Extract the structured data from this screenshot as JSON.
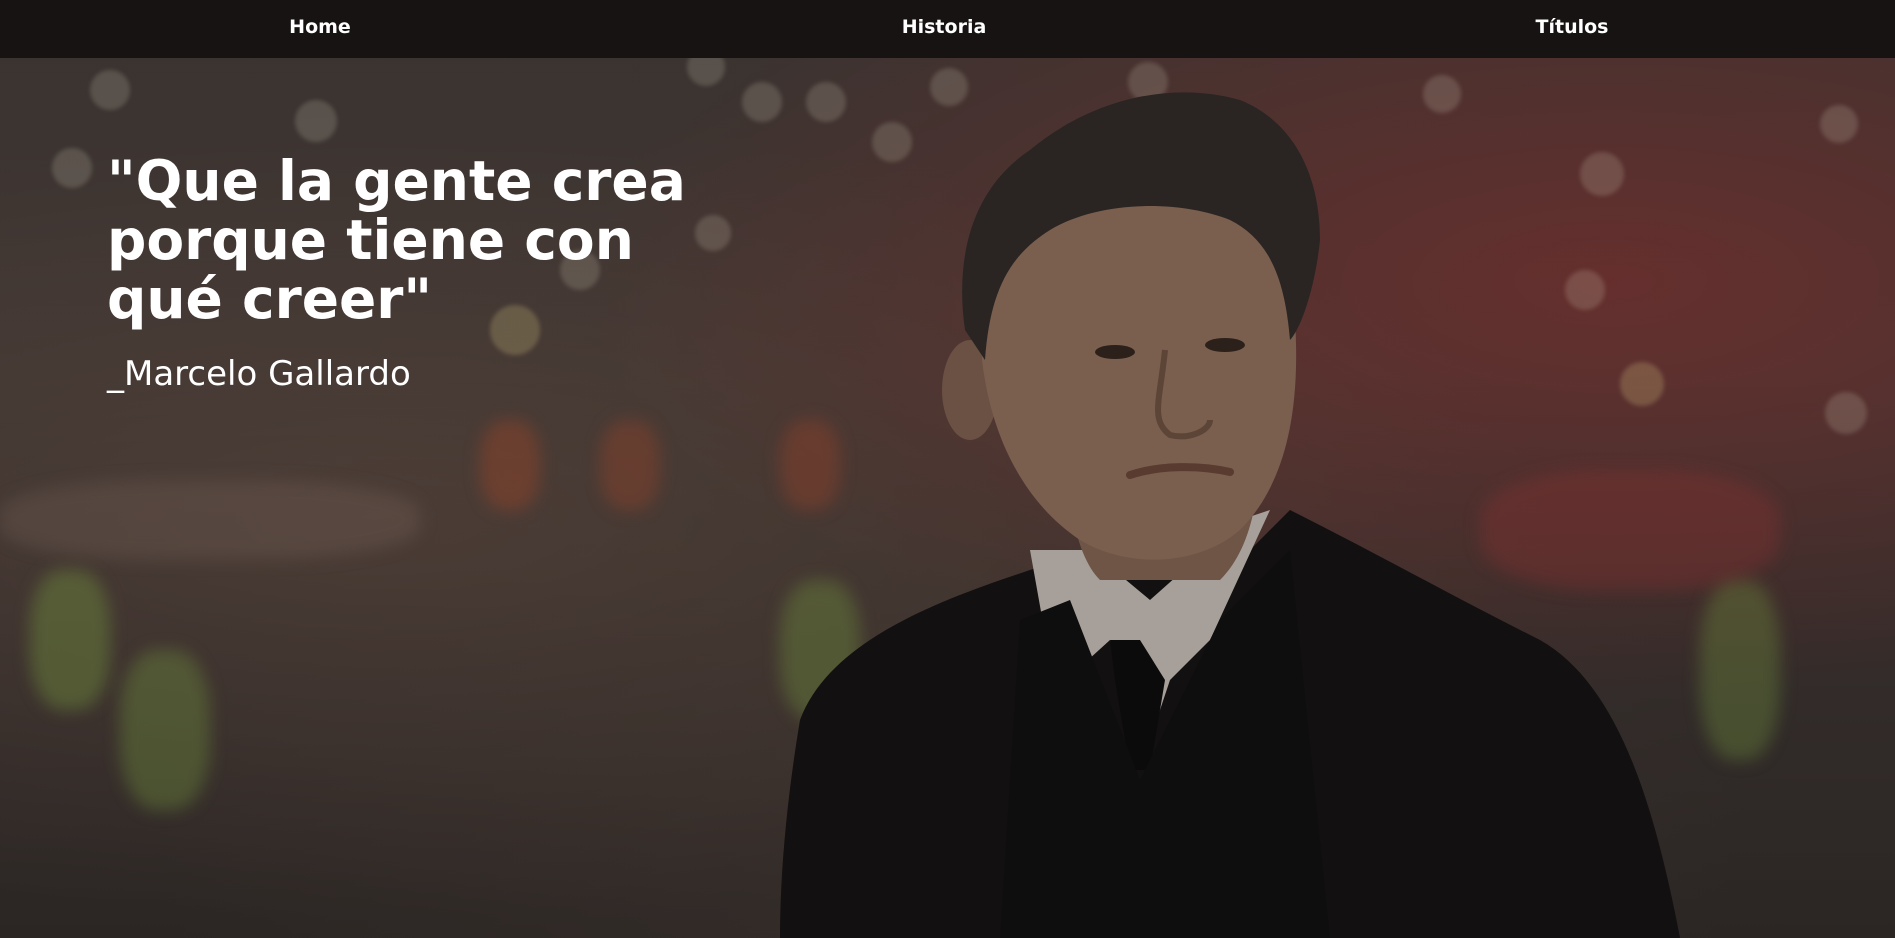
{
  "navbar": {
    "items": [
      {
        "label": "Home"
      },
      {
        "label": "Historia"
      },
      {
        "label": "Títulos"
      }
    ]
  },
  "hero": {
    "quote": "\"Que la gente crea porque tiene con qué creer\"",
    "author": "_Marcelo Gallardo",
    "image": "photo of Marcelo Gallardo in a stadium at night"
  }
}
